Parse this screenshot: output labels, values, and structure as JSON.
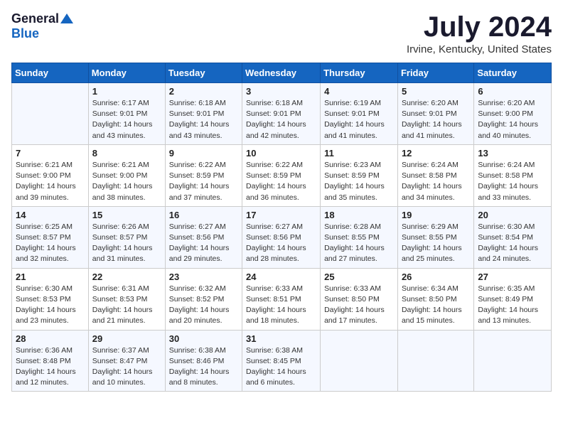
{
  "header": {
    "logo_general": "General",
    "logo_blue": "Blue",
    "month_title": "July 2024",
    "location": "Irvine, Kentucky, United States"
  },
  "days_of_week": [
    "Sunday",
    "Monday",
    "Tuesday",
    "Wednesday",
    "Thursday",
    "Friday",
    "Saturday"
  ],
  "weeks": [
    [
      {
        "day": "",
        "content": ""
      },
      {
        "day": "1",
        "content": "Sunrise: 6:17 AM\nSunset: 9:01 PM\nDaylight: 14 hours\nand 43 minutes."
      },
      {
        "day": "2",
        "content": "Sunrise: 6:18 AM\nSunset: 9:01 PM\nDaylight: 14 hours\nand 43 minutes."
      },
      {
        "day": "3",
        "content": "Sunrise: 6:18 AM\nSunset: 9:01 PM\nDaylight: 14 hours\nand 42 minutes."
      },
      {
        "day": "4",
        "content": "Sunrise: 6:19 AM\nSunset: 9:01 PM\nDaylight: 14 hours\nand 41 minutes."
      },
      {
        "day": "5",
        "content": "Sunrise: 6:20 AM\nSunset: 9:01 PM\nDaylight: 14 hours\nand 41 minutes."
      },
      {
        "day": "6",
        "content": "Sunrise: 6:20 AM\nSunset: 9:00 PM\nDaylight: 14 hours\nand 40 minutes."
      }
    ],
    [
      {
        "day": "7",
        "content": "Sunrise: 6:21 AM\nSunset: 9:00 PM\nDaylight: 14 hours\nand 39 minutes."
      },
      {
        "day": "8",
        "content": "Sunrise: 6:21 AM\nSunset: 9:00 PM\nDaylight: 14 hours\nand 38 minutes."
      },
      {
        "day": "9",
        "content": "Sunrise: 6:22 AM\nSunset: 8:59 PM\nDaylight: 14 hours\nand 37 minutes."
      },
      {
        "day": "10",
        "content": "Sunrise: 6:22 AM\nSunset: 8:59 PM\nDaylight: 14 hours\nand 36 minutes."
      },
      {
        "day": "11",
        "content": "Sunrise: 6:23 AM\nSunset: 8:59 PM\nDaylight: 14 hours\nand 35 minutes."
      },
      {
        "day": "12",
        "content": "Sunrise: 6:24 AM\nSunset: 8:58 PM\nDaylight: 14 hours\nand 34 minutes."
      },
      {
        "day": "13",
        "content": "Sunrise: 6:24 AM\nSunset: 8:58 PM\nDaylight: 14 hours\nand 33 minutes."
      }
    ],
    [
      {
        "day": "14",
        "content": "Sunrise: 6:25 AM\nSunset: 8:57 PM\nDaylight: 14 hours\nand 32 minutes."
      },
      {
        "day": "15",
        "content": "Sunrise: 6:26 AM\nSunset: 8:57 PM\nDaylight: 14 hours\nand 31 minutes."
      },
      {
        "day": "16",
        "content": "Sunrise: 6:27 AM\nSunset: 8:56 PM\nDaylight: 14 hours\nand 29 minutes."
      },
      {
        "day": "17",
        "content": "Sunrise: 6:27 AM\nSunset: 8:56 PM\nDaylight: 14 hours\nand 28 minutes."
      },
      {
        "day": "18",
        "content": "Sunrise: 6:28 AM\nSunset: 8:55 PM\nDaylight: 14 hours\nand 27 minutes."
      },
      {
        "day": "19",
        "content": "Sunrise: 6:29 AM\nSunset: 8:55 PM\nDaylight: 14 hours\nand 25 minutes."
      },
      {
        "day": "20",
        "content": "Sunrise: 6:30 AM\nSunset: 8:54 PM\nDaylight: 14 hours\nand 24 minutes."
      }
    ],
    [
      {
        "day": "21",
        "content": "Sunrise: 6:30 AM\nSunset: 8:53 PM\nDaylight: 14 hours\nand 23 minutes."
      },
      {
        "day": "22",
        "content": "Sunrise: 6:31 AM\nSunset: 8:53 PM\nDaylight: 14 hours\nand 21 minutes."
      },
      {
        "day": "23",
        "content": "Sunrise: 6:32 AM\nSunset: 8:52 PM\nDaylight: 14 hours\nand 20 minutes."
      },
      {
        "day": "24",
        "content": "Sunrise: 6:33 AM\nSunset: 8:51 PM\nDaylight: 14 hours\nand 18 minutes."
      },
      {
        "day": "25",
        "content": "Sunrise: 6:33 AM\nSunset: 8:50 PM\nDaylight: 14 hours\nand 17 minutes."
      },
      {
        "day": "26",
        "content": "Sunrise: 6:34 AM\nSunset: 8:50 PM\nDaylight: 14 hours\nand 15 minutes."
      },
      {
        "day": "27",
        "content": "Sunrise: 6:35 AM\nSunset: 8:49 PM\nDaylight: 14 hours\nand 13 minutes."
      }
    ],
    [
      {
        "day": "28",
        "content": "Sunrise: 6:36 AM\nSunset: 8:48 PM\nDaylight: 14 hours\nand 12 minutes."
      },
      {
        "day": "29",
        "content": "Sunrise: 6:37 AM\nSunset: 8:47 PM\nDaylight: 14 hours\nand 10 minutes."
      },
      {
        "day": "30",
        "content": "Sunrise: 6:38 AM\nSunset: 8:46 PM\nDaylight: 14 hours\nand 8 minutes."
      },
      {
        "day": "31",
        "content": "Sunrise: 6:38 AM\nSunset: 8:45 PM\nDaylight: 14 hours\nand 6 minutes."
      },
      {
        "day": "",
        "content": ""
      },
      {
        "day": "",
        "content": ""
      },
      {
        "day": "",
        "content": ""
      }
    ]
  ]
}
